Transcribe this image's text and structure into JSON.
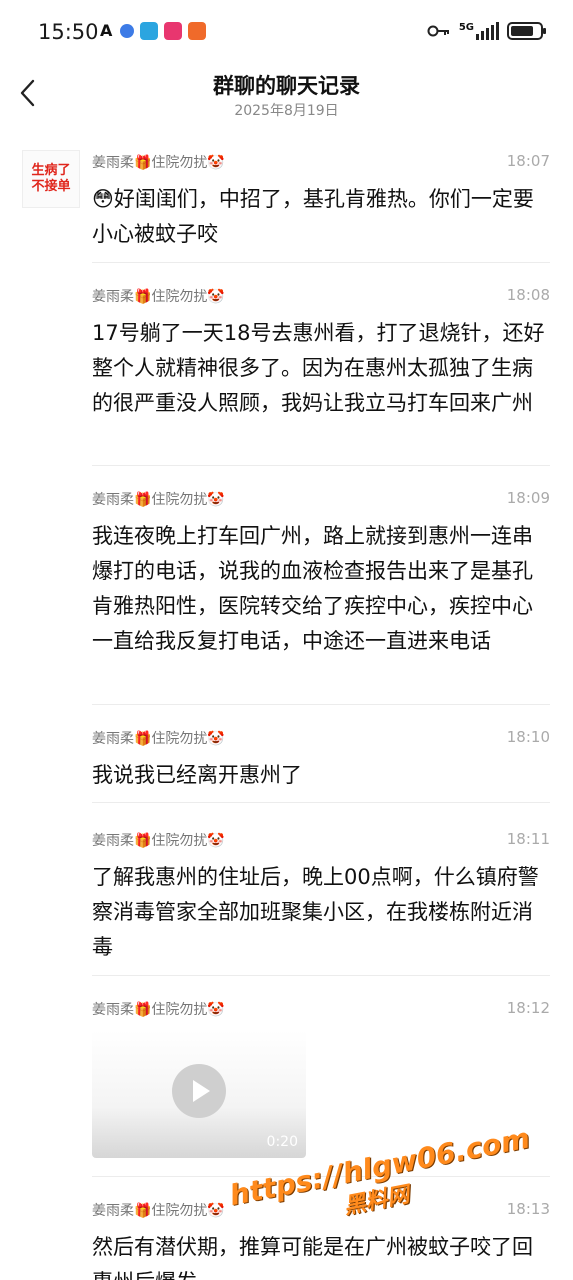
{
  "status_bar": {
    "time": "15:50",
    "network": "5G"
  },
  "header": {
    "title": "群聊的聊天记录",
    "date": "2025年8月19日"
  },
  "avatar_text": [
    "生病了",
    "不接单"
  ],
  "messages": [
    {
      "sender": "姜雨柔🎁住院勿扰🤡",
      "time": "18:07",
      "text": "😳好闺闺们，中招了，基孔肯雅热。你们一定要小心被蚊子咬"
    },
    {
      "sender": "姜雨柔🎁住院勿扰🤡",
      "time": "18:08",
      "text": "17号躺了一天18号去惠州看，打了退烧针，还好整个人就精神很多了。因为在惠州太孤独了生病的很严重没人照顾，我妈让我立马打车回来广州"
    },
    {
      "sender": "姜雨柔🎁住院勿扰🤡",
      "time": "18:09",
      "text": "我连夜晚上打车回广州，路上就接到惠州一连串爆打的电话，说我的血液检查报告出来了是基孔肯雅热阳性，医院转交给了疾控中心，疾控中心一直给我反复打电话，中途还一直进来电话"
    },
    {
      "sender": "姜雨柔🎁住院勿扰🤡",
      "time": "18:10",
      "text": "我说我已经离开惠州了"
    },
    {
      "sender": "姜雨柔🎁住院勿扰🤡",
      "time": "18:11",
      "text": "了解我惠州的住址后，晚上00点啊，什么镇府警察消毒管家全部加班聚集小区，在我楼栋附近消毒"
    },
    {
      "sender": "姜雨柔🎁住院勿扰🤡",
      "time": "18:12",
      "video_duration": "0:20"
    },
    {
      "sender": "姜雨柔🎁住院勿扰🤡",
      "time": "18:13",
      "text": "然后有潜伏期，推算可能是在广州被蚊子咬了回惠州后爆发"
    }
  ],
  "watermark": {
    "url": "https://hlgw06.com",
    "name": "黑料网"
  }
}
